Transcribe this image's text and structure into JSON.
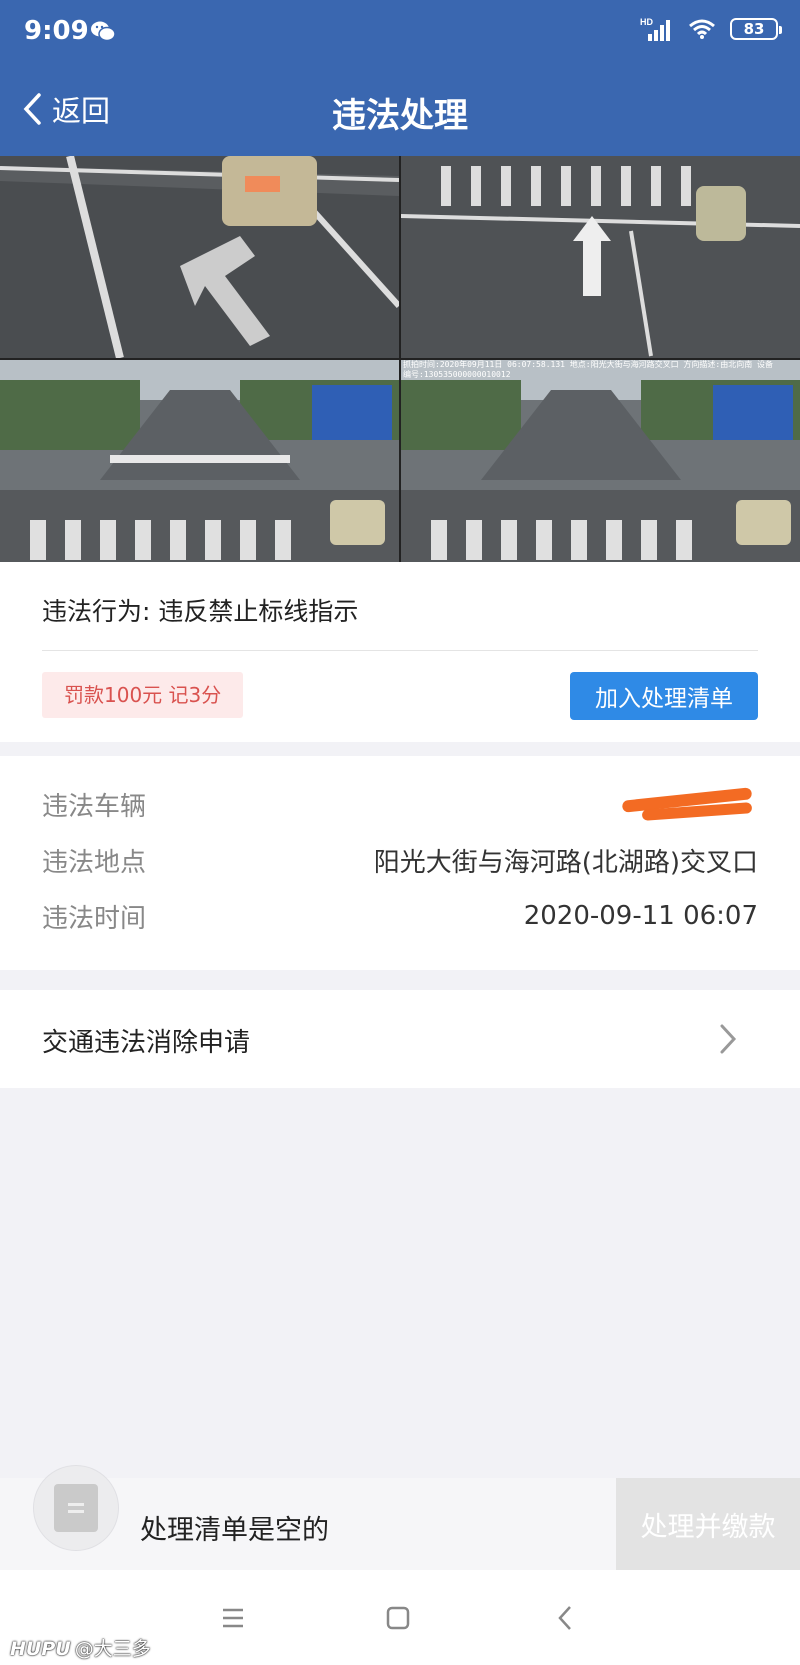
{
  "status_bar": {
    "time": "9:09",
    "network": "HD",
    "battery": "83"
  },
  "header": {
    "back_label": "返回",
    "title": "违法处理"
  },
  "photos": {
    "camera_caption_line1": "抓拍时间:2020年09月11日 06:07:58.131 地点:阳光大街与海河路交叉口 方向描述:由北向南 设备",
    "camera_caption_line2": "编号:130535000000010012"
  },
  "violation": {
    "label": "违法行为: 违反禁止标线指示",
    "fine": "罚款100元 记3分",
    "add_button": "加入处理清单"
  },
  "details": {
    "vehicle_key": "违法车辆",
    "location_key": "违法地点",
    "location_value": "阳光大街与海河路(北湖路)交叉口",
    "time_key": "违法时间",
    "time_value": "2020-09-11 06:07"
  },
  "appeal": {
    "label": "交通违法消除申请"
  },
  "bottom": {
    "empty_text": "处理清单是空的",
    "pay_button": "处理并缴款"
  },
  "watermark": {
    "brand": "HUPU",
    "user": "@大三多"
  },
  "colors": {
    "header": "#3a67b0",
    "primary_button": "#2f8ae6",
    "fine_text": "#d9524f",
    "fine_bg": "#fdeaea",
    "mask": "#f36b23"
  }
}
